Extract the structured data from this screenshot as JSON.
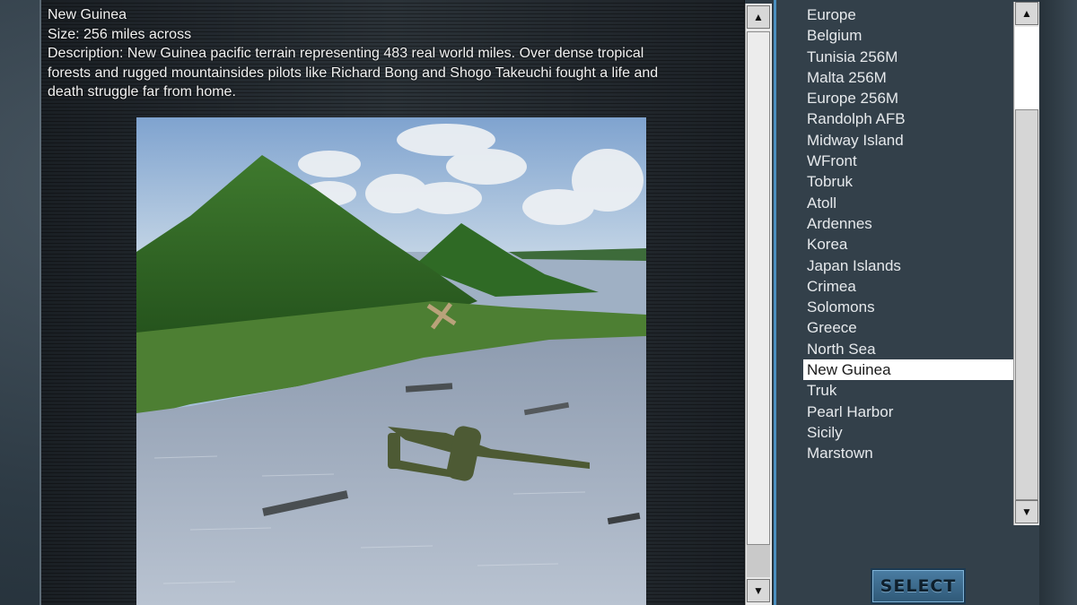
{
  "info": {
    "title": "New Guinea",
    "size": "Size: 256 miles across",
    "description_line1": "Description: New Guinea pacific terrain representing 483 real world miles. Over dense tropical",
    "description_line2": "forests and rugged mountainsides pilots like Richard Bong and Shogo Takeuchi fought a life and",
    "description_line3": "death struggle far from home."
  },
  "preview": {
    "icon": "terrain-preview-image"
  },
  "scrollbars": {
    "up_icon": "arrow-up-icon",
    "down_icon": "arrow-down-icon",
    "up_glyph": "▲",
    "down_glyph": "▼"
  },
  "map_list": {
    "items": [
      "Europe",
      "Belgium",
      "Tunisia 256M",
      "Malta 256M",
      "Europe 256M",
      "Randolph AFB",
      "Midway Island",
      "WFront",
      "Tobruk",
      "Atoll",
      "Ardennes",
      "Korea",
      "Japan Islands",
      "Crimea",
      "Solomons",
      "Greece",
      "North Sea",
      "New Guinea",
      "Truk",
      "Pearl Harbor",
      "Sicily",
      "Marstown"
    ],
    "selected": "New Guinea"
  },
  "buttons": {
    "select_label": "SELECT"
  },
  "colors": {
    "list_background": "#33404a",
    "selected_row": "#ffffff",
    "accent_border": "#4b8fc0",
    "button": "#3f6d8f"
  }
}
